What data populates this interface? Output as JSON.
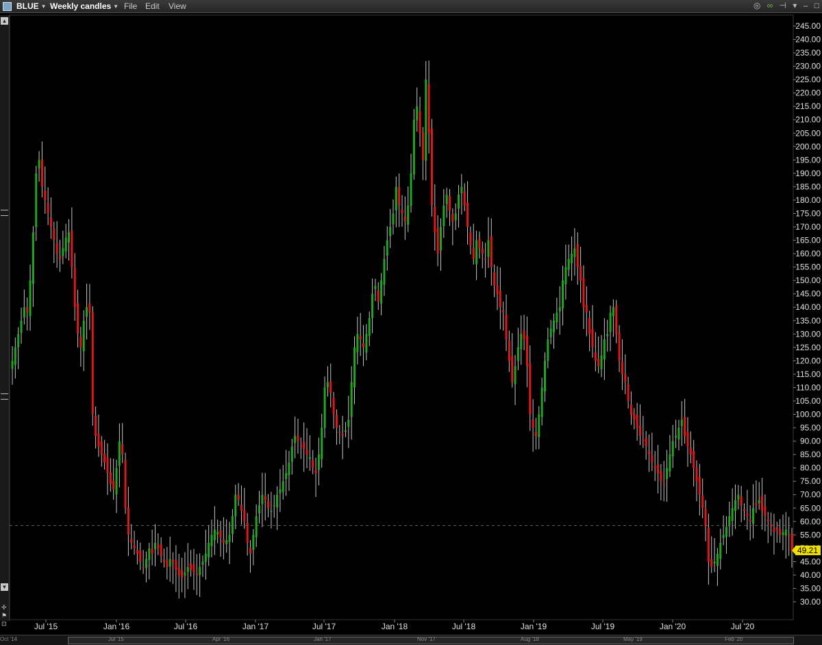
{
  "window": {
    "symbol": "BLUE",
    "interval": "Weekly candles",
    "menu": [
      "File",
      "Edit",
      "View"
    ]
  },
  "colors": {
    "background": "#000000",
    "up_candle": "#1fa81f",
    "down_candle": "#e01818",
    "wick": "#c8c8c8",
    "last_price_bg": "#f0e000",
    "grid_dashed": "#555555"
  },
  "chart_data": {
    "type": "candlestick",
    "title": "",
    "ylim": [
      27,
      247
    ],
    "yticks": [
      "245.00",
      "240.00",
      "235.00",
      "230.00",
      "225.00",
      "220.00",
      "215.00",
      "210.00",
      "205.00",
      "200.00",
      "195.00",
      "190.00",
      "185.00",
      "180.00",
      "175.00",
      "170.00",
      "165.00",
      "160.00",
      "155.00",
      "150.00",
      "145.00",
      "140.00",
      "135.00",
      "130.00",
      "125.00",
      "120.00",
      "115.00",
      "110.00",
      "105.00",
      "100.00",
      "95.00",
      "90.00",
      "85.00",
      "80.00",
      "75.00",
      "70.00",
      "65.00",
      "60.00",
      "55.00",
      "50.00",
      "45.00",
      "40.00",
      "35.00",
      "30.00"
    ],
    "xticks": [
      "Jul '15",
      "Jan '16",
      "Jul '16",
      "Jan '17",
      "Jul '17",
      "Jan '18",
      "Jul '18",
      "Jan '19",
      "Jul '19",
      "Jan '20",
      "Jul '20"
    ],
    "last_price": "49.21",
    "dashed_level": 58.5,
    "series_close": [
      120,
      125,
      130,
      135,
      140,
      138,
      150,
      168,
      190,
      195,
      185,
      180,
      175,
      170,
      165,
      160,
      158,
      162,
      166,
      168,
      155,
      140,
      130,
      125,
      135,
      140,
      138,
      100,
      92,
      88,
      85,
      82,
      78,
      74,
      72,
      80,
      90,
      85,
      65,
      55,
      52,
      50,
      48,
      45,
      43,
      46,
      50,
      48,
      52,
      50,
      47,
      45,
      43,
      46,
      45,
      42,
      40,
      39,
      41,
      43,
      42,
      41,
      40,
      43,
      45,
      48,
      52,
      55,
      57,
      56,
      54,
      52,
      53,
      55,
      62,
      70,
      68,
      64,
      60,
      52,
      48,
      55,
      62,
      66,
      70,
      68,
      65,
      64,
      66,
      70,
      72,
      75,
      78,
      82,
      88,
      92,
      90,
      88,
      87,
      85,
      84,
      80,
      78,
      85,
      95,
      110,
      112,
      108,
      100,
      95,
      93,
      92,
      94,
      98,
      112,
      125,
      130,
      128,
      125,
      130,
      136,
      145,
      148,
      142,
      150,
      158,
      165,
      170,
      175,
      185,
      178,
      175,
      172,
      178,
      190,
      210,
      215,
      205,
      195,
      225,
      205,
      178,
      168,
      160,
      170,
      178,
      182,
      176,
      172,
      175,
      182,
      185,
      178,
      170,
      163,
      158,
      165,
      162,
      160,
      158,
      165,
      155,
      148,
      145,
      140,
      138,
      128,
      120,
      112,
      118,
      125,
      130,
      128,
      118,
      100,
      95,
      92,
      100,
      110,
      120,
      128,
      132,
      135,
      138,
      140,
      150,
      155,
      158,
      160,
      162,
      155,
      150,
      140,
      138,
      130,
      125,
      120,
      118,
      122,
      128,
      130,
      138,
      140,
      130,
      120,
      115,
      112,
      105,
      100,
      98,
      95,
      92,
      90,
      88,
      85,
      82,
      80,
      78,
      75,
      74,
      80,
      85,
      90,
      92,
      95,
      98,
      92,
      88,
      85,
      80,
      75,
      70,
      65,
      58,
      45,
      43,
      45,
      48,
      52,
      55,
      58,
      62,
      65,
      68,
      70,
      66,
      64,
      62,
      60,
      65,
      66,
      68,
      64,
      62,
      60,
      58,
      56,
      57,
      55,
      56,
      57,
      55,
      49
    ]
  }
}
